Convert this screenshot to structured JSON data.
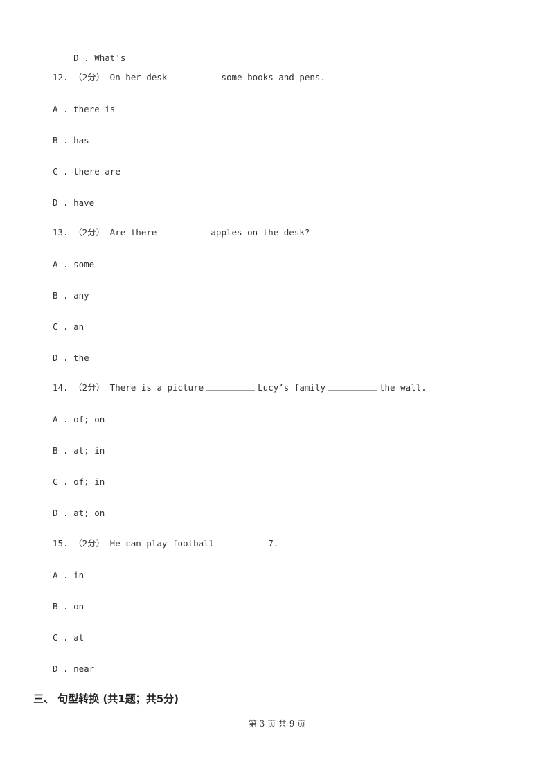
{
  "top_option": {
    "letter": "D",
    "text": "What's"
  },
  "questions": [
    {
      "number": "12.",
      "score": "（2分）",
      "parts": [
        "On her desk",
        "some books and pens."
      ],
      "options": [
        {
          "letter": "A",
          "text": "there is"
        },
        {
          "letter": "B",
          "text": "has"
        },
        {
          "letter": "C",
          "text": "there are"
        },
        {
          "letter": "D",
          "text": "have"
        }
      ]
    },
    {
      "number": "13.",
      "score": "（2分）",
      "parts": [
        "Are there",
        "apples on the desk?"
      ],
      "options": [
        {
          "letter": "A",
          "text": "some"
        },
        {
          "letter": "B",
          "text": "any"
        },
        {
          "letter": "C",
          "text": "an"
        },
        {
          "letter": "D",
          "text": "the"
        }
      ]
    },
    {
      "number": "14.",
      "score": "（2分）",
      "parts": [
        "There is a picture",
        "Lucy’s family",
        "the wall."
      ],
      "options": [
        {
          "letter": "A",
          "text": "of; on"
        },
        {
          "letter": "B",
          "text": "at; in"
        },
        {
          "letter": "C",
          "text": "of; in"
        },
        {
          "letter": "D",
          "text": "at; on"
        }
      ]
    },
    {
      "number": "15.",
      "score": "（2分）",
      "parts": [
        "He can play football",
        "7."
      ],
      "options": [
        {
          "letter": "A",
          "text": "in"
        },
        {
          "letter": "B",
          "text": "on"
        },
        {
          "letter": "C",
          "text": "at"
        },
        {
          "letter": "D",
          "text": "near"
        }
      ]
    }
  ],
  "section": "三、 句型转换 (共1题；共5分)",
  "footer": "第 3 页 共 9 页"
}
